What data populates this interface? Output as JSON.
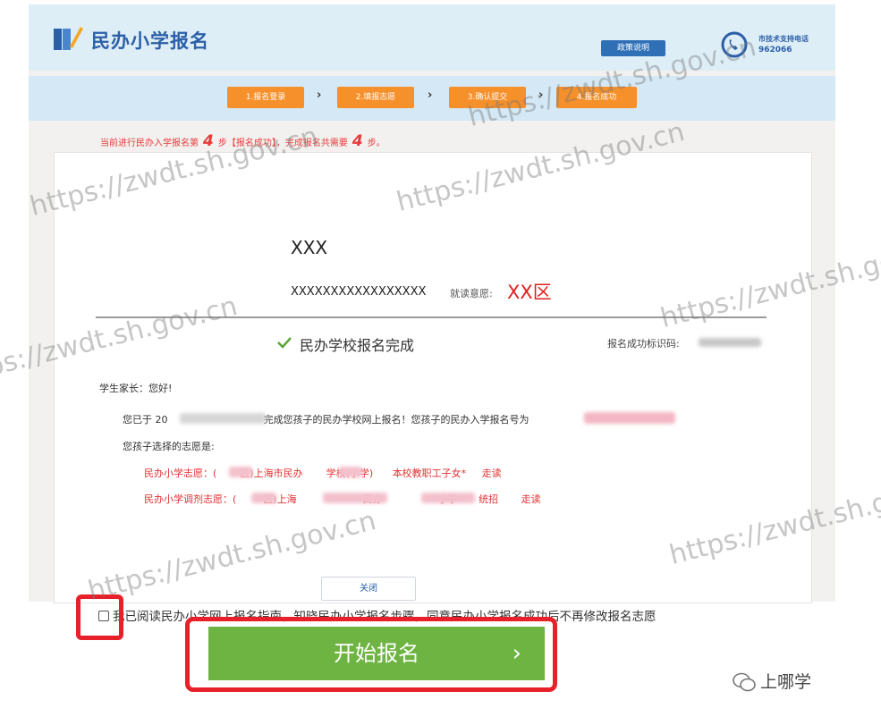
{
  "header": {
    "logo_text": "民办小学报名",
    "policy_button": "政策说明",
    "phone_label": "市技术支持电话",
    "phone_number": "962066"
  },
  "steps": [
    "1.报名登录",
    "2.填报志愿",
    "3.确认提交",
    "4.报名成功"
  ],
  "progress": {
    "prefix": "当前进行民办入学报名第",
    "current_step": "4",
    "middle": "步【报名成功】，完成报名共需要",
    "total_steps": "4",
    "suffix": "步。"
  },
  "student": {
    "name": "XXX",
    "id_number": "XXXXXXXXXXXXXXXXX",
    "district_label": "就读意愿:",
    "district": "XX区"
  },
  "result": {
    "title": "民办学校报名完成",
    "code_label": "报名成功标识码:"
  },
  "letter": {
    "greeting": "学生家长：您好!",
    "line1_prefix": "您已于 20",
    "line1_middle": "完成您孩子的民办学校网上报名！您孩子的民办入学报名号为",
    "line2": "您孩子选择的志愿是:",
    "choice1_label": "民办小学志愿：(",
    "choice1_district": "区)上海市民办",
    "choice1_school": "学校(小学)",
    "choice1_type": "本校教职工子女*",
    "choice1_mode": "走读",
    "choice2_label": "民办小学调剂志愿：(",
    "choice2_district": "区)上海",
    "choice2_school_a": "民办",
    "choice2_school_b": "小学",
    "choice2_type": "统招",
    "choice2_mode": "走读"
  },
  "close_button": "关闭",
  "agree_text": "我已阅读民办小学网上报名指南，知晓民办小学报名步骤，同意民办小学报名成功后不再修改报名志愿",
  "start_button": "开始报名",
  "start_chevron": "›",
  "brand": "上哪学",
  "watermark": "https://zwdt.sh.gov.cn",
  "colors": {
    "accent_blue": "#2b5fa8",
    "step_orange": "#f5902a",
    "highlight_red": "#e8202a",
    "button_green": "#6eb442"
  }
}
